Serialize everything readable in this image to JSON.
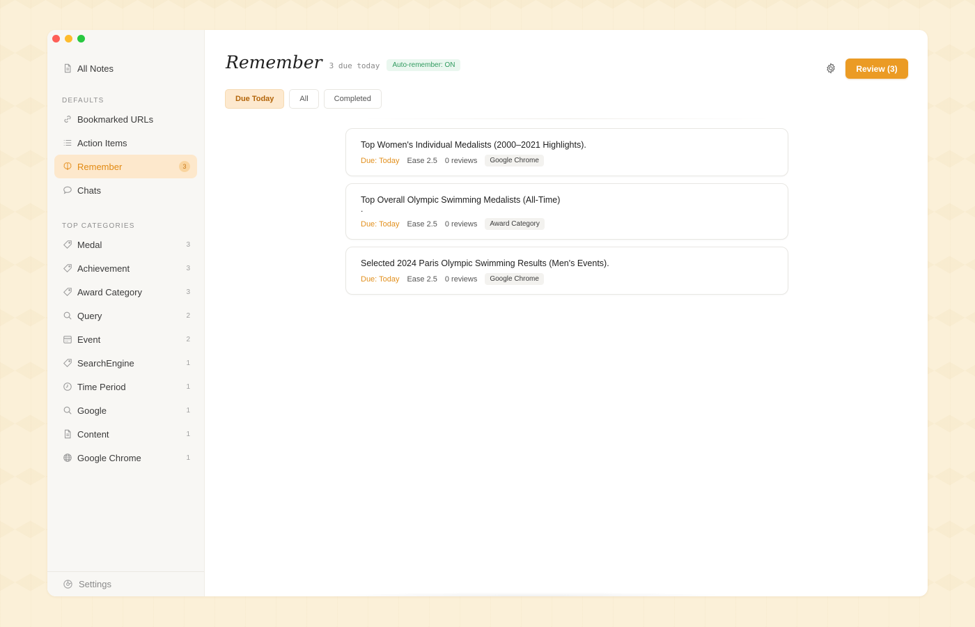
{
  "sidebar": {
    "all_notes": "All Notes",
    "defaults_heading": "DEFAULTS",
    "defaults": [
      {
        "label": "Bookmarked URLs",
        "icon": "link-icon"
      },
      {
        "label": "Action Items",
        "icon": "list-icon"
      },
      {
        "label": "Remember",
        "icon": "brain-icon",
        "count": "3",
        "active": true
      },
      {
        "label": "Chats",
        "icon": "chat-bubble-icon"
      }
    ],
    "categories_heading": "TOP CATEGORIES",
    "categories": [
      {
        "label": "Medal",
        "count": "3",
        "icon": "tag-icon"
      },
      {
        "label": "Achievement",
        "count": "3",
        "icon": "tag-icon"
      },
      {
        "label": "Award Category",
        "count": "3",
        "icon": "tag-icon"
      },
      {
        "label": "Query",
        "count": "2",
        "icon": "search-icon"
      },
      {
        "label": "Event",
        "count": "2",
        "icon": "calendar-icon"
      },
      {
        "label": "SearchEngine",
        "count": "1",
        "icon": "tag-icon"
      },
      {
        "label": "Time Period",
        "count": "1",
        "icon": "clock-icon"
      },
      {
        "label": "Google",
        "count": "1",
        "icon": "search-icon"
      },
      {
        "label": "Content",
        "count": "1",
        "icon": "document-icon"
      },
      {
        "label": "Google Chrome",
        "count": "1",
        "icon": "globe-icon"
      }
    ],
    "settings": "Settings"
  },
  "header": {
    "title": "Remember",
    "due_count": "3 due today",
    "auto_badge": "Auto-remember: ON",
    "review_button": "Review (3)"
  },
  "tabs": [
    {
      "label": "Due Today",
      "active": true
    },
    {
      "label": "All",
      "active": false
    },
    {
      "label": "Completed",
      "active": false
    }
  ],
  "cards": [
    {
      "title": "Top Women's Individual Medalists (2000–2021 Highlights).",
      "extra": "",
      "due": "Due: Today",
      "ease": "Ease 2.5",
      "reviews": "0 reviews",
      "tag": "Google Chrome"
    },
    {
      "title": "Top Overall Olympic Swimming Medalists (All-Time)",
      "extra": ".",
      "due": "Due: Today",
      "ease": "Ease 2.5",
      "reviews": "0 reviews",
      "tag": "Award Category"
    },
    {
      "title": "Selected 2024 Paris Olympic Swimming Results (Men's Events).",
      "extra": "",
      "due": "Due: Today",
      "ease": "Ease 2.5",
      "reviews": "0 reviews",
      "tag": "Google Chrome"
    }
  ],
  "colors": {
    "accent": "#eb9b24",
    "active_bg": "#fde8cc",
    "due_text": "#e2901e",
    "auto_badge_text": "#2f9a5e"
  }
}
